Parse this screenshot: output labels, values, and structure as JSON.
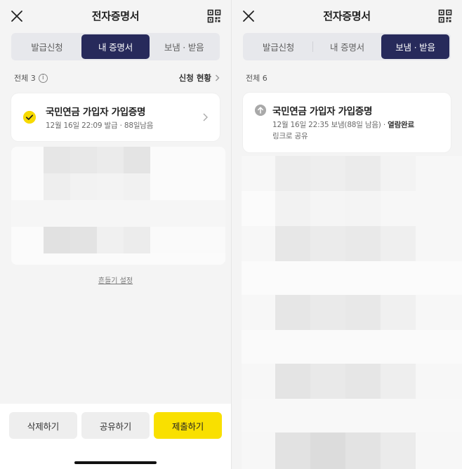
{
  "left": {
    "header": {
      "title": "전자증명서",
      "close_icon": "close-icon",
      "qr_icon": "qr-code-icon"
    },
    "tabs": [
      {
        "label": "발급신청",
        "active": false
      },
      {
        "label": "내 증명서",
        "active": true
      },
      {
        "label": "보냄 · 받음",
        "active": false
      }
    ],
    "count_label": "전체 3",
    "status_link": "신청 현황",
    "certificate": {
      "name": "국민연금 가입자 가입증명",
      "issued": "12월 16일 22:09 발급",
      "separator": "·",
      "remaining": "88일남음"
    },
    "shake_setting": "흔들기 설정",
    "buttons": {
      "delete": "삭제하기",
      "share": "공유하기",
      "submit": "제출하기"
    }
  },
  "right": {
    "header": {
      "title": "전자증명서",
      "close_icon": "close-icon",
      "qr_icon": "qr-code-icon"
    },
    "tabs": [
      {
        "label": "발급신청",
        "active": false
      },
      {
        "label": "내 증명서",
        "active": false
      },
      {
        "label": "보냄 · 받음",
        "active": true
      }
    ],
    "count_label": "전체 6",
    "certificate": {
      "name": "국민연금 가입자 가입증명",
      "sent": "12월 16일 22:35 보냄(88일 남음)",
      "separator": "·",
      "status": "열람완료",
      "method": "링크로 공유"
    }
  },
  "colors": {
    "accent_navy": "#272a5b",
    "accent_yellow": "#f9e000",
    "background": "#f4f4f4"
  }
}
